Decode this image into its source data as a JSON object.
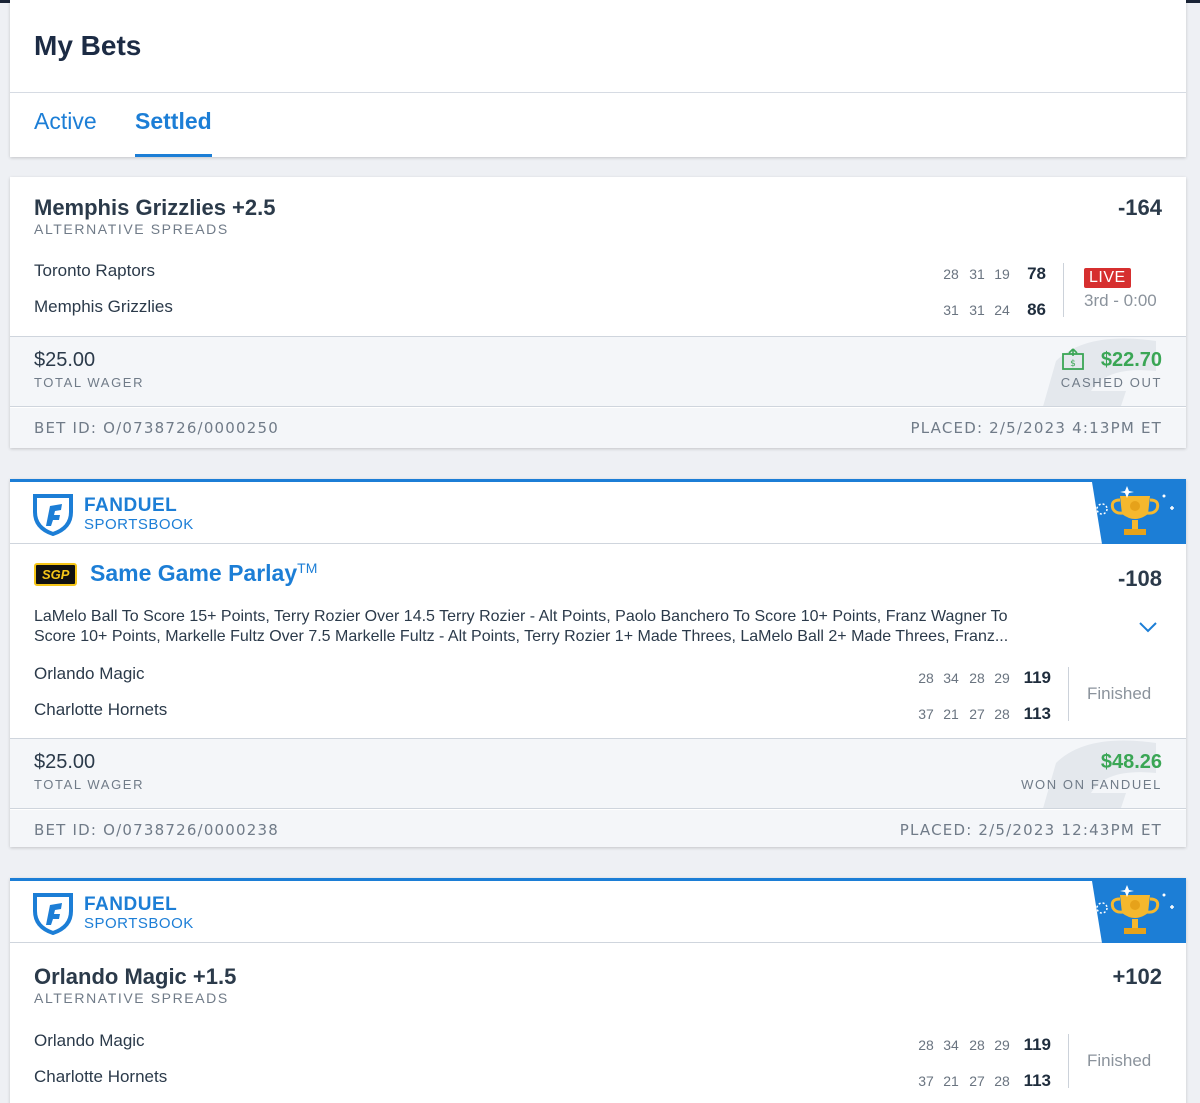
{
  "header": {
    "title": "My Bets",
    "tabs": [
      {
        "label": "Active",
        "active": false
      },
      {
        "label": "Settled",
        "active": true
      }
    ]
  },
  "bets": [
    {
      "title": "Memphis Grizzlies +2.5",
      "market": "ALTERNATIVE SPREADS",
      "odds": "-164",
      "teams": [
        {
          "name": "Toronto Raptors",
          "quarters": [
            "28",
            "31",
            "19"
          ],
          "total": "78"
        },
        {
          "name": "Memphis Grizzlies",
          "quarters": [
            "31",
            "31",
            "24"
          ],
          "total": "86"
        }
      ],
      "status_badge": "LIVE",
      "status": "3rd - 0:00",
      "wager": "$25.00",
      "wager_label": "TOTAL WAGER",
      "payout": "$22.70",
      "payout_label": "CASHED OUT",
      "bet_id": "BET ID: O/0738726/0000250",
      "placed": "PLACED: 2/5/2023 4:13PM ET"
    },
    {
      "brand": "FANDUEL",
      "brand_sub": "SPORTSBOOK",
      "badge": "SGP",
      "title": "Same Game Parlay",
      "title_tm": "TM",
      "odds": "-108",
      "legs_line1": "LaMelo Ball To Score 15+ Points, Terry Rozier Over 14.5 Terry Rozier - Alt Points, Paolo Banchero To Score 10+ Points, Franz Wagner To",
      "legs_line2": "Score 10+ Points, Markelle Fultz Over 7.5 Markelle Fultz - Alt Points, Terry Rozier 1+ Made Threes, LaMelo Ball 2+ Made Threes, Franz...",
      "teams": [
        {
          "name": "Orlando Magic",
          "quarters": [
            "28",
            "34",
            "28",
            "29"
          ],
          "total": "119"
        },
        {
          "name": "Charlotte Hornets",
          "quarters": [
            "37",
            "21",
            "27",
            "28"
          ],
          "total": "113"
        }
      ],
      "status": "Finished",
      "wager": "$25.00",
      "wager_label": "TOTAL WAGER",
      "payout": "$48.26",
      "payout_label": "WON ON FANDUEL",
      "bet_id": "BET ID: O/0738726/0000238",
      "placed": "PLACED: 2/5/2023 12:43PM ET"
    },
    {
      "brand": "FANDUEL",
      "brand_sub": "SPORTSBOOK",
      "title": "Orlando Magic +1.5",
      "market": "ALTERNATIVE SPREADS",
      "odds": "+102",
      "teams": [
        {
          "name": "Orlando Magic",
          "quarters": [
            "28",
            "34",
            "28",
            "29"
          ],
          "total": "119"
        },
        {
          "name": "Charlotte Hornets",
          "quarters": [
            "37",
            "21",
            "27",
            "28"
          ],
          "total": "113"
        }
      ],
      "status": "Finished"
    }
  ],
  "colors": {
    "brand_blue": "#1c7ed6",
    "win_green": "#3aa655",
    "live_red": "#d62f2f",
    "sgp_gold": "#f5c518"
  },
  "icons": [
    "fanduel-shield-icon",
    "trophy-icon",
    "cash-out-icon",
    "chevron-down-icon"
  ]
}
